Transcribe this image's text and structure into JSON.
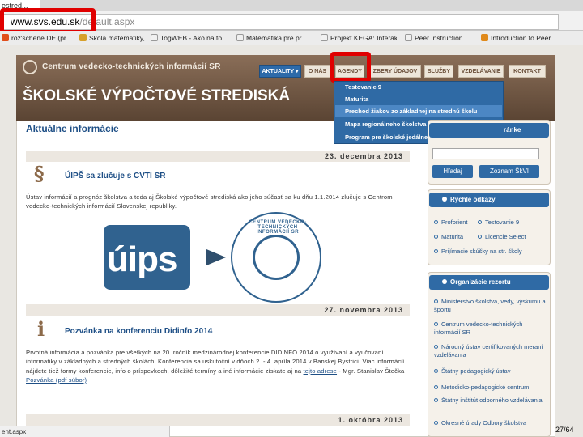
{
  "browser": {
    "tab_title": "estred...",
    "url_domain": "www.svs.edu.sk",
    "url_path": "/default.aspx",
    "status_text": "ent.aspx",
    "bookmarks": [
      "roz'schene.DE (pr...",
      "Skola matematiky, ...",
      "TogWEB - Ako na to...",
      "Matematika pre pr...",
      "Projekt KEGA: Interak...",
      "Peer Instruction",
      "Introduction to Peer..."
    ]
  },
  "site": {
    "logo_text": "Centrum vedecko-technických informácií SR",
    "title": "ŠKOLSKÉ VÝPOČTOVÉ STREDISKÁ",
    "nav": [
      "AKTUALITY ▾",
      "O NÁS",
      "AGENDY",
      "ZBERY ÚDAJOV",
      "SLUŽBY",
      "VZDELÁVANIE",
      "KONTAKT"
    ],
    "dropdown": [
      "Testovanie 9",
      "Maturita",
      "Prechod žiakov zo základnej na strednú školu",
      "Mapa regionálneho školstva",
      "Program pre školské jedálne"
    ]
  },
  "main": {
    "heading": "Aktuálne informácie",
    "posts": [
      {
        "date": "23. decembra 2013",
        "icon": "§",
        "title": "ÚIPŠ sa zlučuje s CVTI SR",
        "body": "Ústav informácií a prognóz školstva a teda aj Školské výpočtové strediská ako jeho súčasť sa ku dňu 1.1.2014 zlučuje s Centrom vedecko-technických informácií Slovenskej republiky."
      },
      {
        "date": "27. novembra 2013",
        "icon": "i",
        "title": "Pozvánka na konferenciu Didinfo 2014",
        "body": "Prvotná informácia a pozvánka pre všetkých na 20. ročník medzinárodnej konferencie DIDINFO 2014 o využívaní a vyučovaní informatiky v základných a stredných školách. Konferencia sa uskutoční v dňoch 2. - 4. apríla 2014 v Banskej Bystrici. Viac informácií nájdete tiež formy konferencie, info o príspevkoch, dôležité termíny a iné informácie získate aj na",
        "link_text": "tejto adrese",
        "body_tail": " - Mgr. Stanislav Štečka",
        "more_link": "Pozvánka (pdf súbor)"
      },
      {
        "date": "1. októbra 2013"
      }
    ],
    "logos": {
      "uips": "úips",
      "cvti_ring": "CENTRUM VEDECKO-TECHNICKÝCH INFORMÁCIÍ SR"
    }
  },
  "sidebar": {
    "search_head": "ránke",
    "search_button": "Hľadaj",
    "index_button": "Zoznam ŠkVI",
    "quick_head": "Rýchle odkazy",
    "quick_links": [
      "Proforient",
      "Testovanie 9",
      "Maturita",
      "Licencie Select",
      "Prijímacie skúšky na str. školy"
    ],
    "org_head": "Organizácie rezortu",
    "org_links": [
      "Ministerstvo školstva, vedy, výskumu a športu",
      "Centrum vedecko-technických informácií SR",
      "Národný ústav certifikovaných meraní vzdelávania",
      "Štátny pedagogický ústav",
      "Metodicko-pedagogické centrum",
      "Štátny inštitút odborného vzdelávania",
      "Okresné úrady Odbory školstva"
    ]
  },
  "slide_counter": "27/64"
}
